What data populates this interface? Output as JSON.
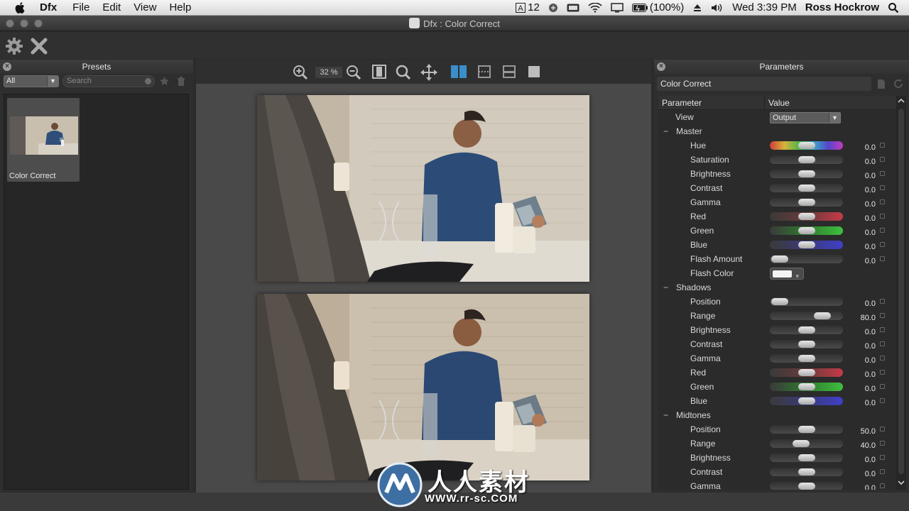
{
  "menubar": {
    "app_name": "Dfx",
    "menus": [
      "File",
      "Edit",
      "View",
      "Help"
    ],
    "font_size_indicator": "12",
    "battery": "(100%)",
    "datetime": "Wed 3:39 PM",
    "user": "Ross Hockrow"
  },
  "window": {
    "title": "Dfx : Color Correct"
  },
  "presets": {
    "header": "Presets",
    "filter_value": "All",
    "search_placeholder": "Search",
    "items": [
      {
        "label": "Color Correct"
      }
    ]
  },
  "viewer": {
    "zoom": "32 %"
  },
  "parameters": {
    "header": "Parameters",
    "effect_name": "Color Correct",
    "col_parameter": "Parameter",
    "col_value": "Value",
    "view_label": "View",
    "view_value": "Output",
    "groups": {
      "master": "Master",
      "shadows": "Shadows",
      "midtones": "Midtones"
    },
    "rows": {
      "hue": {
        "label": "Hue",
        "value": "0.0",
        "pos": 0.5
      },
      "saturation": {
        "label": "Saturation",
        "value": "0.0",
        "pos": 0.5
      },
      "brightness": {
        "label": "Brightness",
        "value": "0.0",
        "pos": 0.5
      },
      "contrast": {
        "label": "Contrast",
        "value": "0.0",
        "pos": 0.5
      },
      "gamma": {
        "label": "Gamma",
        "value": "0.0",
        "pos": 0.5
      },
      "red": {
        "label": "Red",
        "value": "0.0",
        "pos": 0.5
      },
      "green": {
        "label": "Green",
        "value": "0.0",
        "pos": 0.5
      },
      "blue": {
        "label": "Blue",
        "value": "0.0",
        "pos": 0.5
      },
      "flash_amount": {
        "label": "Flash Amount",
        "value": "0.0",
        "pos": 0.0
      },
      "flash_color": {
        "label": "Flash Color"
      },
      "sh_position": {
        "label": "Position",
        "value": "0.0",
        "pos": 0.0
      },
      "sh_range": {
        "label": "Range",
        "value": "80.0",
        "pos": 0.8
      },
      "sh_brightness": {
        "label": "Brightness",
        "value": "0.0",
        "pos": 0.5
      },
      "sh_contrast": {
        "label": "Contrast",
        "value": "0.0",
        "pos": 0.5
      },
      "sh_gamma": {
        "label": "Gamma",
        "value": "0.0",
        "pos": 0.5
      },
      "sh_red": {
        "label": "Red",
        "value": "0.0",
        "pos": 0.5
      },
      "sh_green": {
        "label": "Green",
        "value": "0.0",
        "pos": 0.5
      },
      "sh_blue": {
        "label": "Blue",
        "value": "0.0",
        "pos": 0.5
      },
      "mt_position": {
        "label": "Position",
        "value": "50.0",
        "pos": 0.5
      },
      "mt_range": {
        "label": "Range",
        "value": "40.0",
        "pos": 0.4
      },
      "mt_brightness": {
        "label": "Brightness",
        "value": "0.0",
        "pos": 0.5
      },
      "mt_contrast": {
        "label": "Contrast",
        "value": "0.0",
        "pos": 0.5
      },
      "mt_gamma": {
        "label": "Gamma",
        "value": "0.0",
        "pos": 0.5
      }
    }
  },
  "watermark": {
    "chinese": "人人素材",
    "url": "WWW.rr-sc.COM"
  },
  "colors": {
    "hue_track": "linear-gradient(90deg,#d13b3b,#d6b43a,#4fb54a,#3aa7c9,#5445c8,#c43bc1)",
    "red_track": "linear-gradient(90deg,#3a3a3a,#6a3a3a,#c63a48)",
    "green_track": "linear-gradient(90deg,#3a3a3a,#2f7a2f,#3fbf3f)",
    "blue_track": "linear-gradient(90deg,#3a3a3a,#3a3a7a,#4040c8)",
    "accent_blue": "#3a8ec9"
  }
}
